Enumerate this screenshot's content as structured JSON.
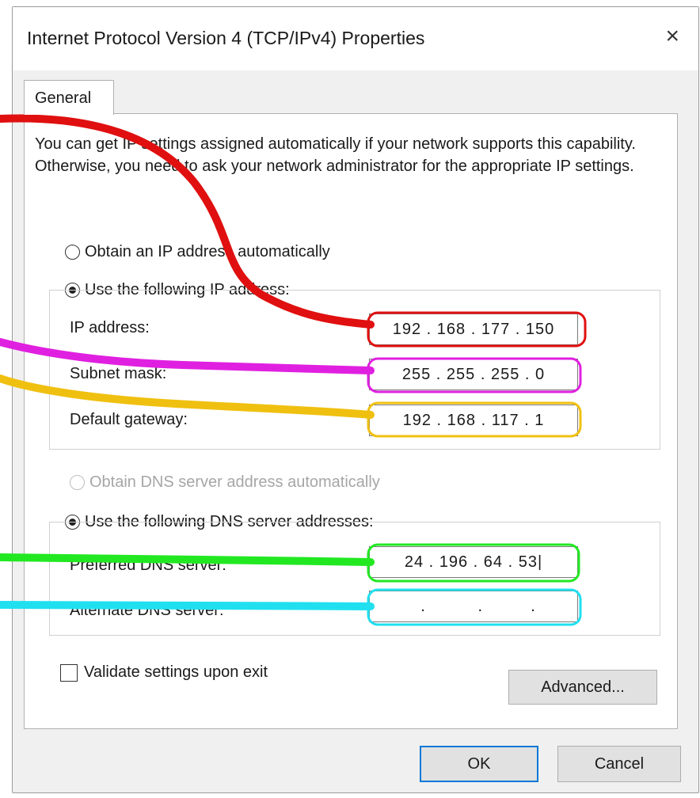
{
  "window": {
    "title": "Internet Protocol Version 4 (TCP/IPv4) Properties",
    "close_symbol": "×"
  },
  "tabs": [
    {
      "label": "General"
    }
  ],
  "description": "You can get IP settings assigned automatically if your network supports this capability. Otherwise, you need to ask your network administrator for the appropriate IP settings.",
  "ip_mode": {
    "auto_label": "Obtain an IP address automatically",
    "manual_label": "Use the following IP address:",
    "selected": "manual"
  },
  "ip_fields": {
    "ip_address": {
      "label": "IP address:",
      "octets": [
        "192",
        "168",
        "177",
        "150"
      ]
    },
    "subnet_mask": {
      "label": "Subnet mask:",
      "octets": [
        "255",
        "255",
        "255",
        "0"
      ]
    },
    "default_gateway": {
      "label": "Default gateway:",
      "octets": [
        "192",
        "168",
        "117",
        "1"
      ]
    }
  },
  "dns_mode": {
    "auto_label": "Obtain DNS server address automatically",
    "auto_disabled": true,
    "manual_label": "Use the following DNS server addresses:",
    "selected": "manual"
  },
  "dns_fields": {
    "preferred": {
      "label": "Preferred DNS server:",
      "octets": [
        "24",
        "196",
        "64",
        "53"
      ]
    },
    "alternate": {
      "label": "Alternate DNS server:",
      "octets": [
        "",
        "",
        "",
        ""
      ]
    }
  },
  "validate": {
    "label": "Validate settings upon exit",
    "checked": false
  },
  "buttons": {
    "advanced": "Advanced...",
    "ok": "OK",
    "cancel": "Cancel"
  },
  "annotation_colors": {
    "ip_address": "#e01010",
    "subnet_mask": "#e020e0",
    "default_gateway": "#f0c010",
    "preferred_dns": "#22e822",
    "alternate_dns": "#20e0f0"
  },
  "ui_colors": {
    "accent": "#0078d7",
    "panel_bg": "#ffffff",
    "dialog_bg": "#f0f0f0"
  }
}
